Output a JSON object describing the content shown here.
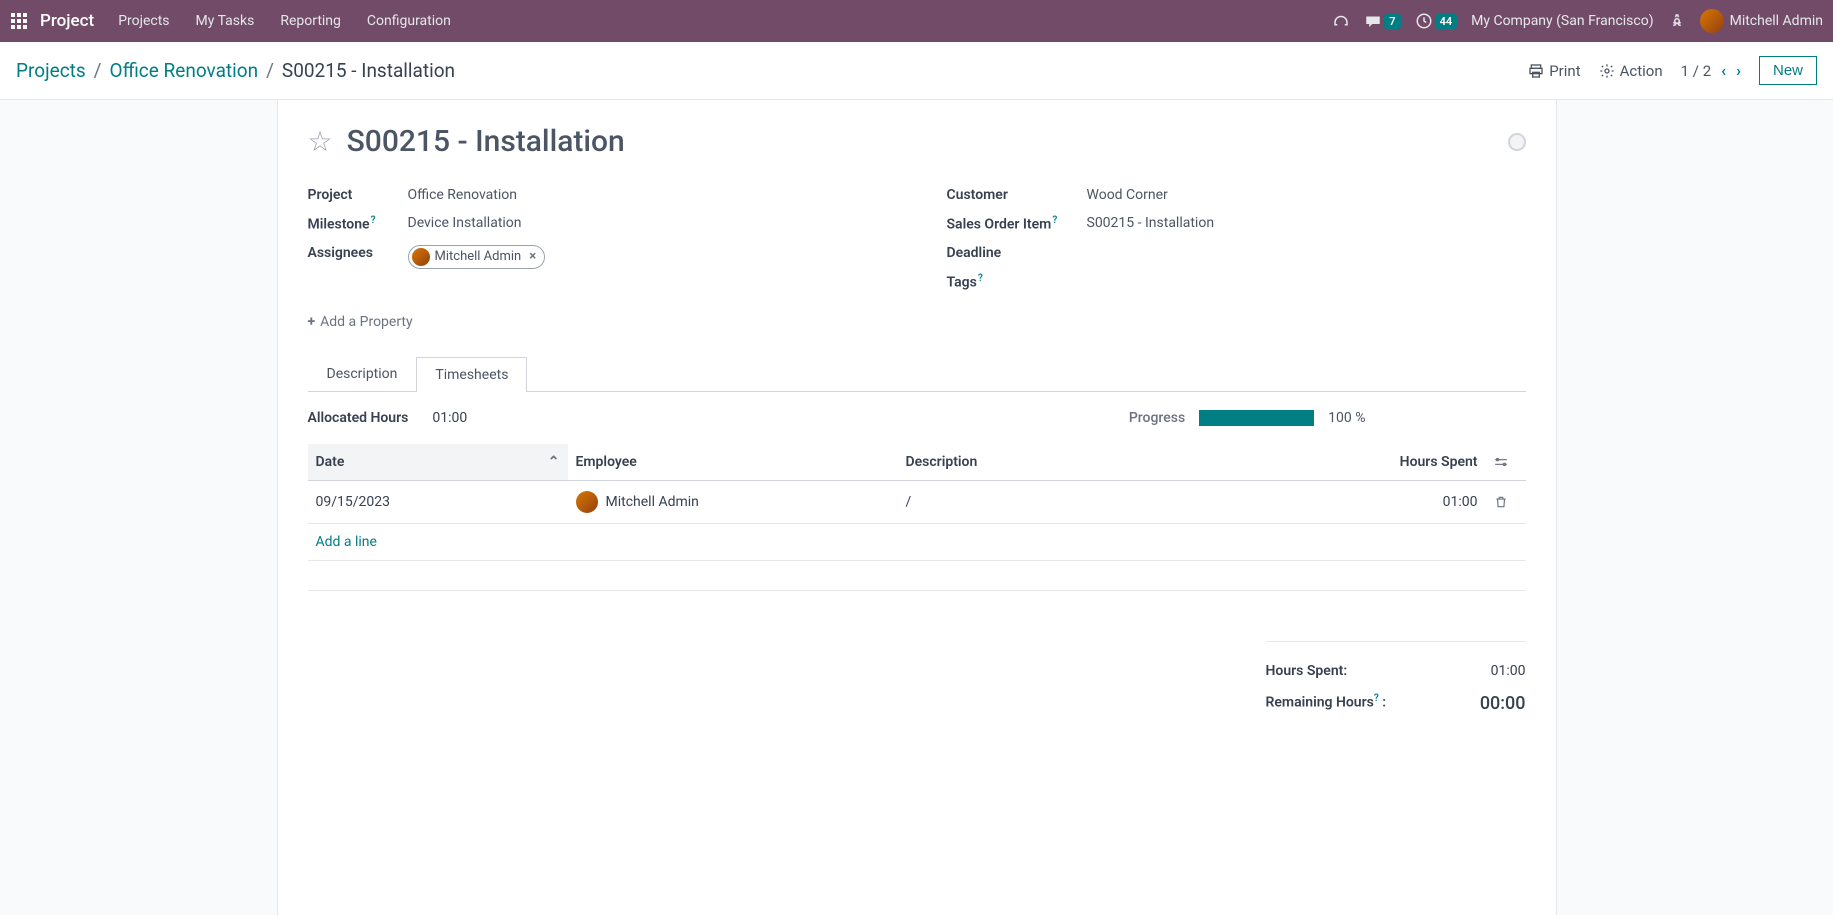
{
  "topbar": {
    "brand": "Project",
    "menu": [
      "Projects",
      "My Tasks",
      "Reporting",
      "Configuration"
    ],
    "messages_badge": "7",
    "activities_badge": "44",
    "company": "My Company (San Francisco)",
    "user": "Mitchell Admin"
  },
  "breadcrumb": {
    "items": [
      "Projects",
      "Office Renovation"
    ],
    "current": "S00215 - Installation"
  },
  "cp": {
    "print": "Print",
    "action": "Action",
    "pager": "1 / 2",
    "new": "New"
  },
  "task": {
    "title": "S00215 - Installation",
    "fields_left": {
      "project": {
        "label": "Project",
        "value": "Office Renovation"
      },
      "milestone": {
        "label": "Milestone",
        "value": "Device Installation"
      },
      "assignees": {
        "label": "Assignees",
        "value": "Mitchell Admin"
      }
    },
    "fields_right": {
      "customer": {
        "label": "Customer",
        "value": "Wood Corner"
      },
      "sales_order": {
        "label": "Sales Order Item",
        "value": "S00215 - Installation"
      },
      "deadline": {
        "label": "Deadline",
        "value": ""
      },
      "tags": {
        "label": "Tags",
        "value": ""
      }
    },
    "add_property": "Add a Property"
  },
  "tabs": {
    "description": "Description",
    "timesheets": "Timesheets"
  },
  "timesheets": {
    "allocated_label": "Allocated Hours",
    "allocated_value": "01:00",
    "progress_label": "Progress",
    "progress_pct": "100 %",
    "columns": {
      "date": "Date",
      "employee": "Employee",
      "description": "Description",
      "hours": "Hours Spent"
    },
    "rows": [
      {
        "date": "09/15/2023",
        "employee": "Mitchell Admin",
        "description": "/",
        "hours": "01:00"
      }
    ],
    "add_line": "Add a line",
    "summary": {
      "hours_spent_label": "Hours Spent:",
      "hours_spent_value": "01:00",
      "remaining_label": "Remaining Hours",
      "remaining_suffix": ":",
      "remaining_value": "00:00"
    }
  }
}
